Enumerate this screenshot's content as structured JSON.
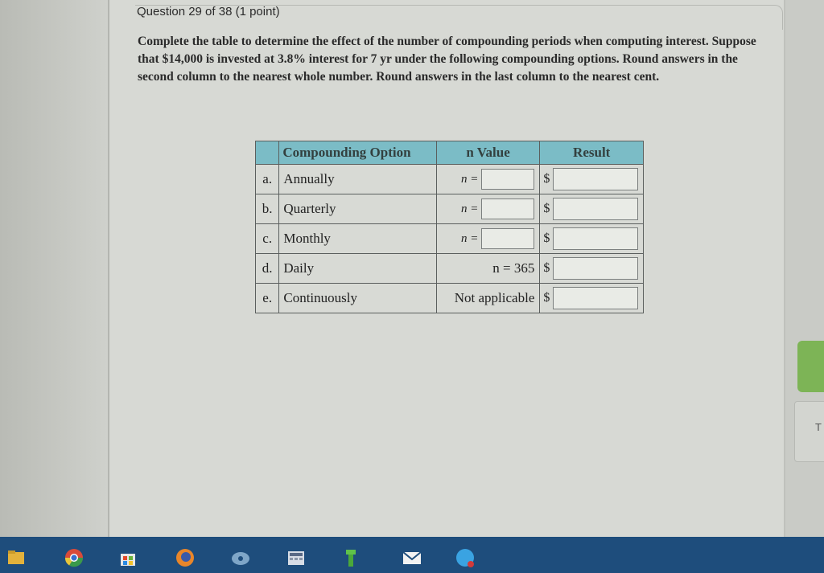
{
  "question": {
    "title": "Question 29 of 38 (1 point)",
    "text": "Complete the table to determine the effect of the number of compounding periods when computing interest. Suppose that $14,000 is invested at 3.8% interest for 7 yr under the following compounding options. Round answers in the second column to the nearest whole number. Round answers in the last column to the nearest cent."
  },
  "table": {
    "headers": {
      "option": "Compounding Option",
      "n": "n Value",
      "result": "Result"
    },
    "rows": [
      {
        "label": "a.",
        "option": "Annually",
        "n_prefix": "n =",
        "n_text": "",
        "result_prefix": "$"
      },
      {
        "label": "b.",
        "option": "Quarterly",
        "n_prefix": "n =",
        "n_text": "",
        "result_prefix": "$"
      },
      {
        "label": "c.",
        "option": "Monthly",
        "n_prefix": "n =",
        "n_text": "",
        "result_prefix": "$"
      },
      {
        "label": "d.",
        "option": "Daily",
        "n_prefix": "",
        "n_text": "n = 365",
        "result_prefix": "$"
      },
      {
        "label": "e.",
        "option": "Continuously",
        "n_prefix": "",
        "n_text": "Not applicable",
        "result_prefix": "$"
      }
    ]
  },
  "side_tab": {
    "label": "T"
  },
  "taskbar": {
    "icons": [
      "file-explorer-icon",
      "chrome-icon",
      "store-icon",
      "firefox-icon",
      "media-icon",
      "calculator-icon",
      "app-icon",
      "mail-icon",
      "skype-icon"
    ]
  }
}
